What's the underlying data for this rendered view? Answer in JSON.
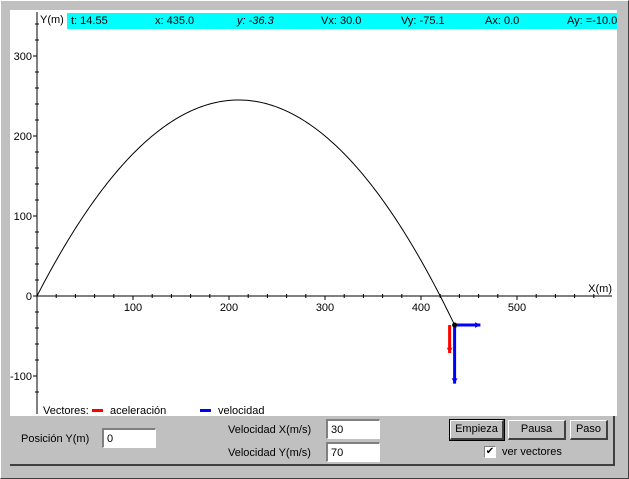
{
  "readout": {
    "t": "t: 14.55",
    "x": "x: 435.0",
    "y": "y: -36.3",
    "vx": "Vx: 30.0",
    "vy": "Vy: -75.1",
    "ax": "Ax: 0.0",
    "ay": "Ay: =-10.0"
  },
  "axes": {
    "y_label": "Y(m)",
    "x_label": "X(m)",
    "y_ticks": [
      "300",
      "200",
      "100",
      "0",
      "-100"
    ],
    "x_ticks": [
      "100",
      "200",
      "300",
      "400",
      "500"
    ]
  },
  "chart_data": {
    "type": "line",
    "xlabel": "X(m)",
    "ylabel": "Y(m)",
    "xlim": [
      0,
      590
    ],
    "ylim": [
      -130,
      345
    ],
    "gravity": -10,
    "v0x": 30,
    "v0y": 70,
    "t_end": 14.55,
    "current_point": {
      "x": 435.0,
      "y": -36.3
    },
    "velocity_vector": {
      "vx": 30.0,
      "vy": -75.1
    },
    "acceleration_vector": {
      "ax": 0.0,
      "ay": -10.0
    }
  },
  "legend": {
    "title": "Vectores:",
    "acceleration": "aceleración",
    "velocity": "velocidad",
    "acceleration_color": "#ff0000",
    "velocity_color": "#0000ff"
  },
  "controls": {
    "pos_y_label": "Posición Y(m)",
    "pos_y_value": "0",
    "vel_x_label": "Velocidad X(m/s)",
    "vel_x_value": "30",
    "vel_y_label": "Velocidad Y(m/s)",
    "vel_y_value": "70",
    "start_button": "Empieza",
    "pause_button": "Pausa",
    "step_button": "Paso",
    "show_vectors_label": "ver vectores",
    "show_vectors_checked": true
  },
  "colors": {
    "readout_bg": "#00ffff",
    "panel_bg": "#c0c0c0",
    "canvas_bg": "#ffffff"
  }
}
